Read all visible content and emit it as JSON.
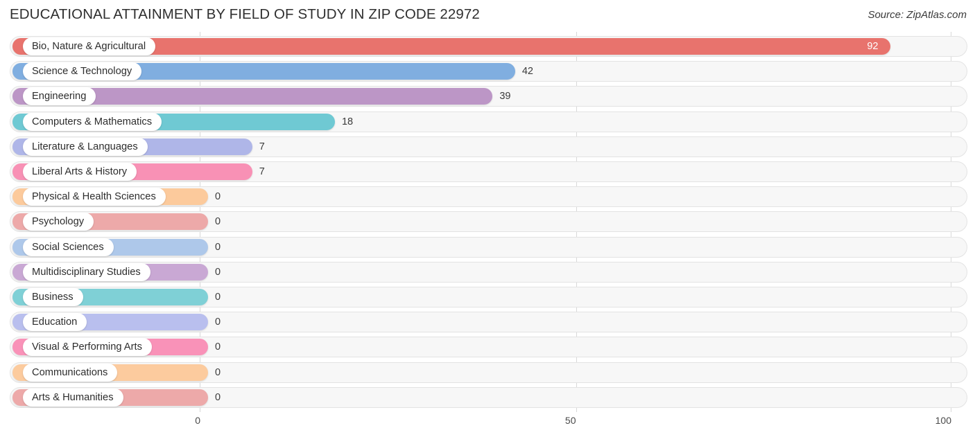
{
  "header": {
    "title": "EDUCATIONAL ATTAINMENT BY FIELD OF STUDY IN ZIP CODE 22972",
    "source": "Source: ZipAtlas.com"
  },
  "chart_data": {
    "type": "bar",
    "orientation": "horizontal",
    "title": "EDUCATIONAL ATTAINMENT BY FIELD OF STUDY IN ZIP CODE 22972",
    "subtitle": "Source: ZipAtlas.com",
    "xlabel": "",
    "ylabel": "",
    "xlim": [
      0,
      100
    ],
    "xticks": [
      0,
      50,
      100
    ],
    "xtick_labels": [
      "0",
      "50",
      "100"
    ],
    "grid": true,
    "legend": false,
    "categories": [
      "Bio, Nature & Agricultural",
      "Science & Technology",
      "Engineering",
      "Computers & Mathematics",
      "Literature & Languages",
      "Liberal Arts & History",
      "Physical & Health Sciences",
      "Psychology",
      "Social Sciences",
      "Multidisciplinary Studies",
      "Business",
      "Education",
      "Visual & Performing Arts",
      "Communications",
      "Arts & Humanities"
    ],
    "values": [
      92,
      42,
      39,
      18,
      7,
      7,
      0,
      0,
      0,
      0,
      0,
      0,
      0,
      0,
      0
    ],
    "value_labels": [
      "92",
      "42",
      "39",
      "18",
      "7",
      "7",
      "0",
      "0",
      "0",
      "0",
      "0",
      "0",
      "0",
      "0",
      "0"
    ],
    "colors": [
      "#e8736d",
      "#80aee0",
      "#bc96c6",
      "#6fc9d3",
      "#afb6e8",
      "#f891b5",
      "#fcca9c",
      "#eda9a9",
      "#aec8ea",
      "#c9a8d4",
      "#7fd0d6",
      "#b9bfee",
      "#f992b8",
      "#fccb9e",
      "#eda9a9"
    ]
  }
}
